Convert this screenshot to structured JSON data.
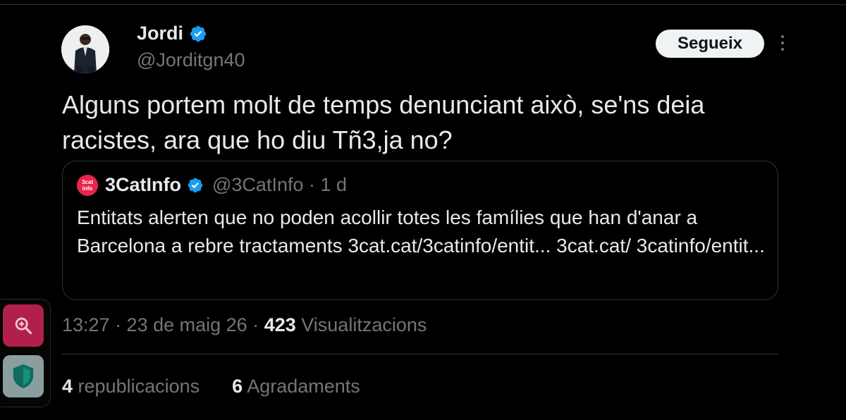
{
  "tweet": {
    "author": {
      "display_name": "Jordi",
      "handle": "@Jorditgn40",
      "verified": true,
      "avatar_icon": "person-avatar"
    },
    "follow_label": "Segueix",
    "text": "Alguns portem molt de temps denunciant això, se'ns deia racistes, ara que ho diu Tñ3,ja no?",
    "quoted": {
      "logo_text": "3cat info",
      "name": "3CatInfo",
      "handle_time": "@3CatInfo · 1 d",
      "text": "Entitats alerten que no poden acollir totes les famílies que han d'anar a Barcelona a rebre tractaments 3cat.cat/3catinfo/entit... 3cat.cat/ 3catinfo/entit..."
    },
    "timestamp": "13:27 · 23 de maig 26 · ",
    "views_count": "423",
    "views_label": "Visualitzacions",
    "reposts_count": "4",
    "reposts_label": "republicacions",
    "likes_count": "6",
    "likes_label": "Agradaments"
  },
  "colors": {
    "background": "#000000",
    "verified_blue": "#1d9bf0",
    "secondary_text": "#71767b",
    "logo_red": "#e8254b"
  }
}
